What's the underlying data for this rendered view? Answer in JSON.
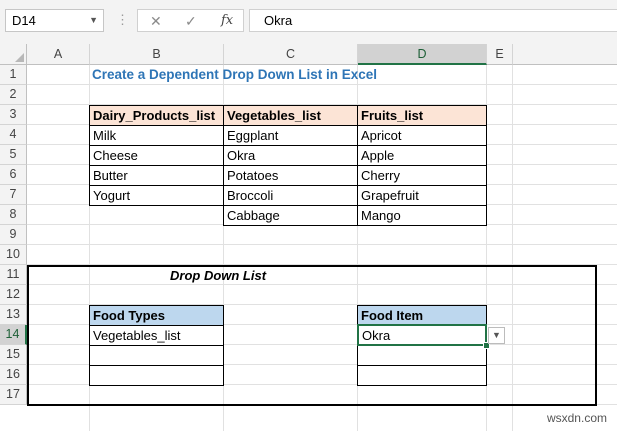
{
  "formula_bar": {
    "name_box": "D14",
    "formula_value": "Okra",
    "cancel_glyph": "✕",
    "enter_glyph": "✓",
    "fx_label": "fx"
  },
  "columns": [
    "A",
    "B",
    "C",
    "D",
    "E"
  ],
  "rows": [
    "1",
    "2",
    "3",
    "4",
    "5",
    "6",
    "7",
    "8",
    "9",
    "10",
    "11",
    "12",
    "13",
    "14",
    "15",
    "16",
    "17"
  ],
  "sheet": {
    "title": "Create a Dependent Drop Down List in Excel",
    "lists": {
      "dairy_header": "Dairy_Products_list",
      "vegetables_header": "Vegetables_list",
      "fruits_header": "Fruits_list",
      "dairy": [
        "Milk",
        "Cheese",
        "Butter",
        "Yogurt"
      ],
      "vegetables": [
        "Eggplant",
        "Okra",
        "Potatoes",
        "Broccoli",
        "Cabbage"
      ],
      "fruits": [
        "Apricot",
        "Apple",
        "Cherry",
        "Grapefruit",
        "Mango"
      ]
    },
    "dropdown_title": "Drop Down List",
    "food_types_header": "Food Types",
    "food_types_value": "Vegetables_list",
    "food_item_header": "Food Item",
    "food_item_value": "Okra"
  },
  "colors": {
    "accent": "#217346",
    "title_blue": "#2e75b6",
    "header_peach": "#fce4d6",
    "header_blue": "#bdd7ee"
  },
  "icons": {
    "name_box_dropdown": "chevron-down-icon",
    "cell_dropdown": "dropdown-arrow-icon"
  },
  "watermark": "wsxdn.com"
}
